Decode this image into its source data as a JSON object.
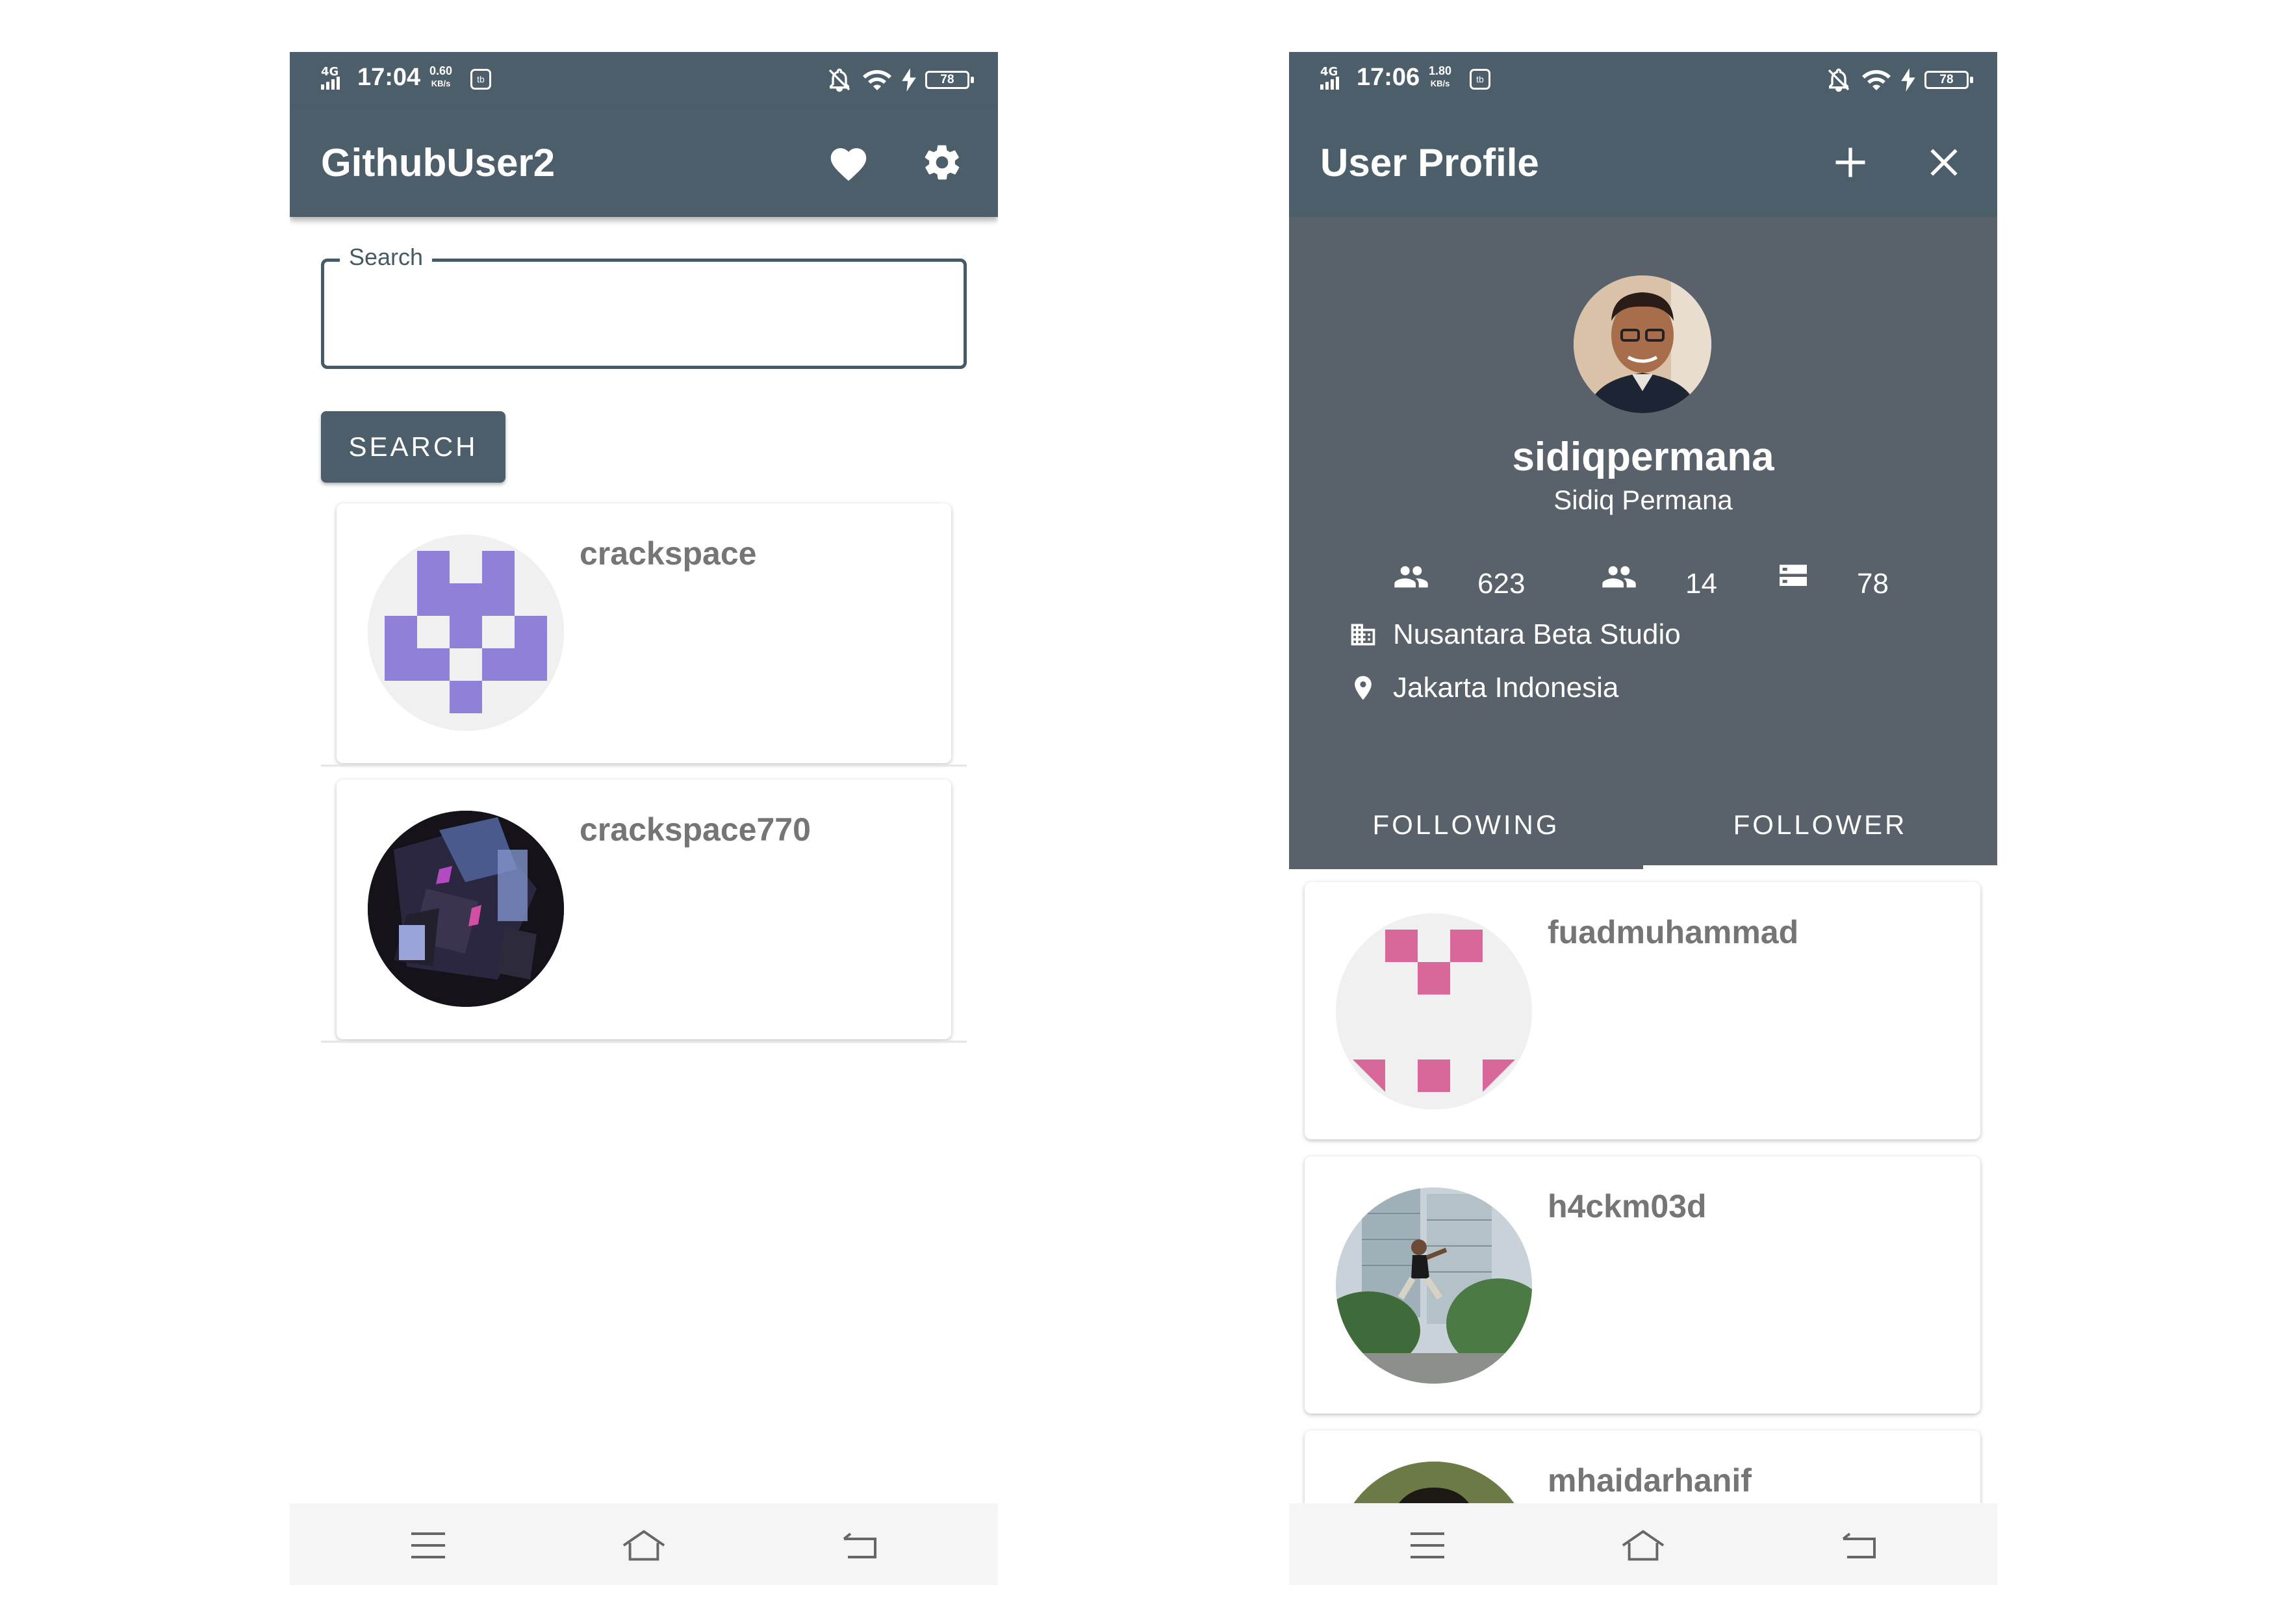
{
  "left_screen": {
    "status_bar": {
      "time": "17:04",
      "speed_value": "0.60",
      "speed_unit": "KB/s",
      "network": "4G",
      "app_icon_text": "tb",
      "battery": "78"
    },
    "app_bar": {
      "title": "GithubUser2",
      "icons": [
        "heart-icon",
        "gear-icon"
      ]
    },
    "search": {
      "label": "Search",
      "value": "",
      "button_label": "SEARCH"
    },
    "results": [
      {
        "username": "crackspace",
        "avatar": "identicon",
        "avatar_color": "#9080d8"
      },
      {
        "username": "crackspace770",
        "avatar": "photo"
      }
    ]
  },
  "right_screen": {
    "status_bar": {
      "time": "17:06",
      "speed_value": "1.80",
      "speed_unit": "KB/s",
      "network": "4G",
      "app_icon_text": "tb",
      "battery": "78"
    },
    "app_bar": {
      "title": "User Profile",
      "icons": [
        "plus-icon",
        "close-icon"
      ]
    },
    "profile": {
      "username": "sidiqpermana",
      "name": "Sidiq Permana",
      "followers": "623",
      "following": "14",
      "repositories": "78",
      "company": "Nusantara Beta Studio",
      "location": "Jakarta Indonesia"
    },
    "tabs": [
      {
        "label": "FOLLOWING",
        "selected": false
      },
      {
        "label": "FOLLOWER",
        "selected": true
      }
    ],
    "list": [
      {
        "username": "fuadmuhammad",
        "avatar": "identicon",
        "avatar_color": "#d8679a"
      },
      {
        "username": "h4ckm03d",
        "avatar": "photo"
      },
      {
        "username": "mhaidarhanif",
        "avatar": "photo"
      }
    ]
  },
  "colors": {
    "primary": "#4d5e6b",
    "profile_header": "#59626a",
    "text_secondary": "#757575"
  }
}
